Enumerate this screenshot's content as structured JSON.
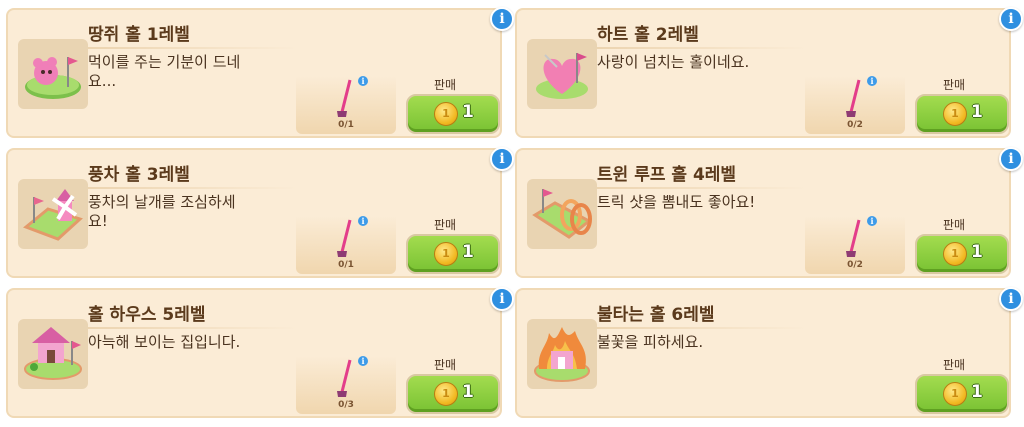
{
  "sell_label": "판매",
  "info_icon": "i",
  "cards": [
    {
      "title": "땅쥐 홀 1레벨",
      "desc": "먹이를 주는 기분이 드네요...",
      "progress": "0/1",
      "price": "1",
      "color": "#f07fb8",
      "accent": "#e4588f"
    },
    {
      "title": "하트 홀 2레벨",
      "desc": "사랑이 넘치는 홀이네요.",
      "progress": "0/2",
      "price": "1",
      "color": "#f27fb3",
      "accent": "#d94c8c"
    },
    {
      "title": "풍차 홀 3레벨",
      "desc": "풍차의 날개를 조심하세요!",
      "progress": "0/1",
      "price": "1",
      "color": "#f58ac0",
      "accent": "#e8668f"
    },
    {
      "title": "트윈 루프 홀 4레벨",
      "desc": "트릭 샷을 뽐내도 좋아요!",
      "progress": "0/2",
      "price": "1",
      "color": "#f3a55e",
      "accent": "#e8854a"
    },
    {
      "title": "홀 하우스 5레벨",
      "desc": "아늑해 보이는 집입니다.",
      "progress": "0/3",
      "price": "1",
      "color": "#f082bf",
      "accent": "#d85fa3"
    },
    {
      "title": "불타는 홀 6레벨",
      "desc": "불꽃을 피하세요.",
      "progress": "",
      "price": "1",
      "color": "#f08a3c",
      "accent": "#e9535a"
    }
  ]
}
